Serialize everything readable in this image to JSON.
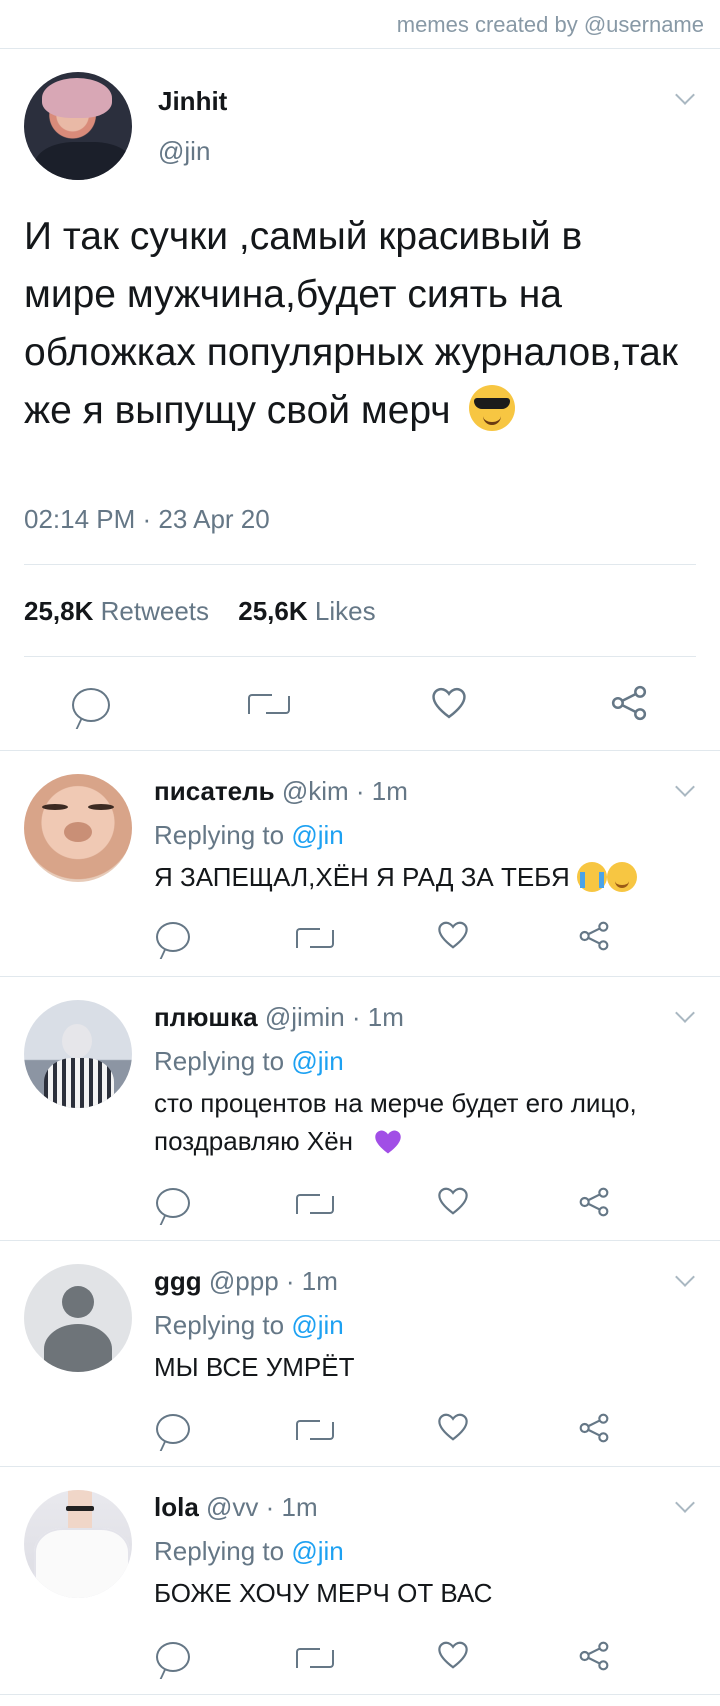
{
  "watermark": "memes created by @username",
  "main_tweet": {
    "name": "Jinhit",
    "handle": "@jin",
    "text": "И так сучки ,самый красивый в мире мужчина,будет сиять на обложках популярных журналов,так же я выпущу свой мерч",
    "emoji": "smiling-face-with-sunglasses",
    "timestamp": "02:14 PM · 23 Apr 20",
    "retweets_count": "25,8K",
    "retweets_label": "Retweets",
    "likes_count": "25,6K",
    "likes_label": "Likes"
  },
  "replies": [
    {
      "name": "писатель",
      "meta": "@kim · 1m",
      "replying_prefix": "Replying to",
      "replying_handle": "@jin",
      "text": "Я ЗАПЕЩАЛ,ХЁН Я РАД ЗА ТЕБЯ",
      "emojis": [
        "loudly-crying-face",
        "face-with-hand-over-mouth"
      ]
    },
    {
      "name": "плюшка",
      "meta": "@jimin · 1m",
      "replying_prefix": "Replying to",
      "replying_handle": "@jin",
      "text": "сто процентов на мерче будет его лицо, поздравляю Хён",
      "emojis": [
        "purple-heart"
      ]
    },
    {
      "name": "ggg",
      "meta": "@ppp · 1m",
      "replying_prefix": "Replying to",
      "replying_handle": "@jin",
      "text": "МЫ ВСЕ УМРЁТ",
      "emojis": []
    },
    {
      "name": "lola",
      "meta": "@vv · 1m",
      "replying_prefix": "Replying to",
      "replying_handle": "@jin",
      "text": "БОЖЕ ХОЧУ МЕРЧ ОТ ВАС",
      "emojis": []
    }
  ],
  "colors": {
    "text": "#14171a",
    "secondary": "#657786",
    "link": "#1da1f2",
    "divider": "#e1e8ed"
  }
}
